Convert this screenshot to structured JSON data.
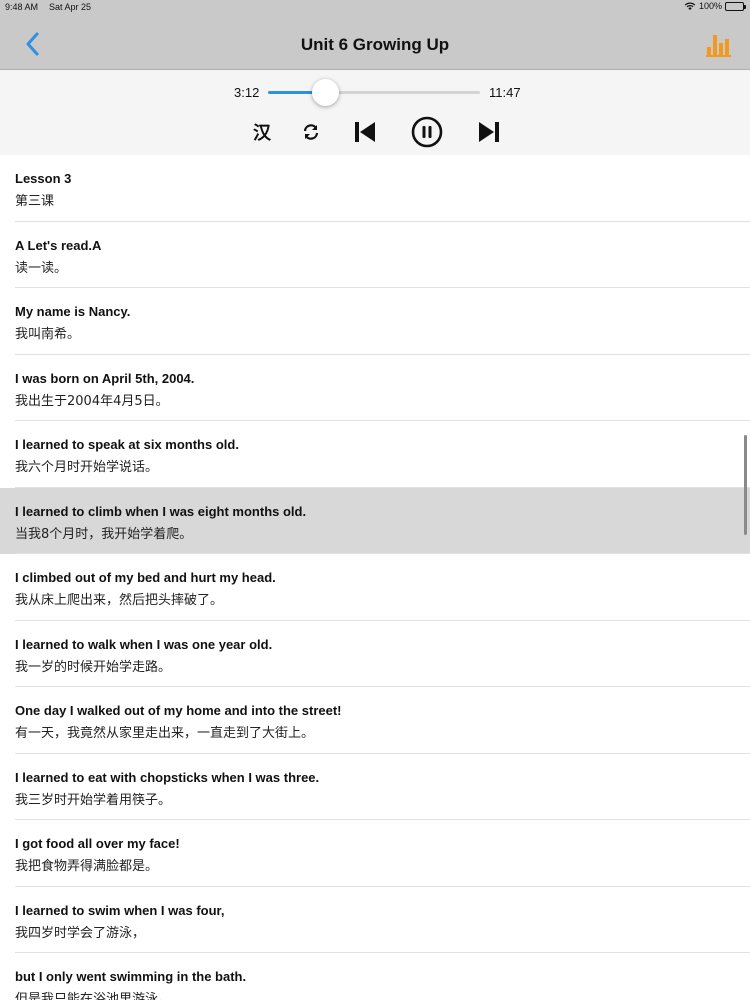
{
  "status_bar": {
    "time": "9:48 AM",
    "date": "Sat Apr 25",
    "battery": "100%"
  },
  "nav": {
    "title": "Unit 6 Growing Up",
    "back_icon": "chevron-left-icon",
    "right_icon": "bar-chart-icon",
    "accent_color": "#f39a1e",
    "back_color": "#2f8fe0"
  },
  "player": {
    "current_time": "3:12",
    "total_time": "11:47",
    "progress": 0.27,
    "lang_toggle": "汉",
    "controls": [
      "repeat-icon",
      "skip-back-icon",
      "pause-icon",
      "skip-forward-icon"
    ]
  },
  "sentences": [
    {
      "en": "Lesson 3",
      "cn": "第三课"
    },
    {
      "en": "A Let's read.A",
      "cn": "读一读。"
    },
    {
      "en": "My name is Nancy.",
      "cn": "我叫南希。"
    },
    {
      "en": "I was born on April 5th, 2004.",
      "cn": "我出生于2004年4月5日。"
    },
    {
      "en": "I learned to speak at six months old.",
      "cn": "我六个月时开始学说话。"
    },
    {
      "en": "I learned to climb when I was eight months old.",
      "cn": "当我8个月时，我开始学着爬。"
    },
    {
      "en": "I climbed out of my bed and hurt my head.",
      "cn": "我从床上爬出来，然后把头摔破了。"
    },
    {
      "en": "I learned to walk when I was one year old.",
      "cn": "我一岁的时候开始学走路。"
    },
    {
      "en": "One day I walked out of my home and into the street!",
      "cn": "有一天，我竟然从家里走出来，一直走到了大街上。"
    },
    {
      "en": "I learned to eat with chopsticks when I was three.",
      "cn": "我三岁时开始学着用筷子。"
    },
    {
      "en": "I got food all over my face!",
      "cn": "我把食物弄得满脸都是。"
    },
    {
      "en": "I learned to swim when I was four,",
      "cn": "我四岁时学会了游泳，"
    },
    {
      "en": "but I only went swimming in the bath.",
      "cn": "但是我只能在浴池里游泳。"
    }
  ],
  "active_index": 5
}
